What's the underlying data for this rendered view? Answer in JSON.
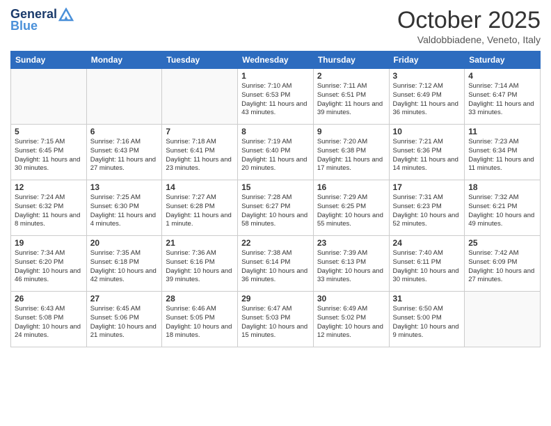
{
  "header": {
    "logo_line1": "General",
    "logo_line2": "Blue",
    "month": "October 2025",
    "location": "Valdobbiadene, Veneto, Italy"
  },
  "days_of_week": [
    "Sunday",
    "Monday",
    "Tuesday",
    "Wednesday",
    "Thursday",
    "Friday",
    "Saturday"
  ],
  "weeks": [
    [
      {
        "day": "",
        "text": "",
        "empty": true
      },
      {
        "day": "",
        "text": "",
        "empty": true
      },
      {
        "day": "",
        "text": "",
        "empty": true
      },
      {
        "day": "1",
        "text": "Sunrise: 7:10 AM\nSunset: 6:53 PM\nDaylight: 11 hours and 43 minutes."
      },
      {
        "day": "2",
        "text": "Sunrise: 7:11 AM\nSunset: 6:51 PM\nDaylight: 11 hours and 39 minutes."
      },
      {
        "day": "3",
        "text": "Sunrise: 7:12 AM\nSunset: 6:49 PM\nDaylight: 11 hours and 36 minutes."
      },
      {
        "day": "4",
        "text": "Sunrise: 7:14 AM\nSunset: 6:47 PM\nDaylight: 11 hours and 33 minutes."
      }
    ],
    [
      {
        "day": "5",
        "text": "Sunrise: 7:15 AM\nSunset: 6:45 PM\nDaylight: 11 hours and 30 minutes."
      },
      {
        "day": "6",
        "text": "Sunrise: 7:16 AM\nSunset: 6:43 PM\nDaylight: 11 hours and 27 minutes."
      },
      {
        "day": "7",
        "text": "Sunrise: 7:18 AM\nSunset: 6:41 PM\nDaylight: 11 hours and 23 minutes."
      },
      {
        "day": "8",
        "text": "Sunrise: 7:19 AM\nSunset: 6:40 PM\nDaylight: 11 hours and 20 minutes."
      },
      {
        "day": "9",
        "text": "Sunrise: 7:20 AM\nSunset: 6:38 PM\nDaylight: 11 hours and 17 minutes."
      },
      {
        "day": "10",
        "text": "Sunrise: 7:21 AM\nSunset: 6:36 PM\nDaylight: 11 hours and 14 minutes."
      },
      {
        "day": "11",
        "text": "Sunrise: 7:23 AM\nSunset: 6:34 PM\nDaylight: 11 hours and 11 minutes."
      }
    ],
    [
      {
        "day": "12",
        "text": "Sunrise: 7:24 AM\nSunset: 6:32 PM\nDaylight: 11 hours and 8 minutes."
      },
      {
        "day": "13",
        "text": "Sunrise: 7:25 AM\nSunset: 6:30 PM\nDaylight: 11 hours and 4 minutes."
      },
      {
        "day": "14",
        "text": "Sunrise: 7:27 AM\nSunset: 6:28 PM\nDaylight: 11 hours and 1 minute."
      },
      {
        "day": "15",
        "text": "Sunrise: 7:28 AM\nSunset: 6:27 PM\nDaylight: 10 hours and 58 minutes."
      },
      {
        "day": "16",
        "text": "Sunrise: 7:29 AM\nSunset: 6:25 PM\nDaylight: 10 hours and 55 minutes."
      },
      {
        "day": "17",
        "text": "Sunrise: 7:31 AM\nSunset: 6:23 PM\nDaylight: 10 hours and 52 minutes."
      },
      {
        "day": "18",
        "text": "Sunrise: 7:32 AM\nSunset: 6:21 PM\nDaylight: 10 hours and 49 minutes."
      }
    ],
    [
      {
        "day": "19",
        "text": "Sunrise: 7:34 AM\nSunset: 6:20 PM\nDaylight: 10 hours and 46 minutes."
      },
      {
        "day": "20",
        "text": "Sunrise: 7:35 AM\nSunset: 6:18 PM\nDaylight: 10 hours and 42 minutes."
      },
      {
        "day": "21",
        "text": "Sunrise: 7:36 AM\nSunset: 6:16 PM\nDaylight: 10 hours and 39 minutes."
      },
      {
        "day": "22",
        "text": "Sunrise: 7:38 AM\nSunset: 6:14 PM\nDaylight: 10 hours and 36 minutes."
      },
      {
        "day": "23",
        "text": "Sunrise: 7:39 AM\nSunset: 6:13 PM\nDaylight: 10 hours and 33 minutes."
      },
      {
        "day": "24",
        "text": "Sunrise: 7:40 AM\nSunset: 6:11 PM\nDaylight: 10 hours and 30 minutes."
      },
      {
        "day": "25",
        "text": "Sunrise: 7:42 AM\nSunset: 6:09 PM\nDaylight: 10 hours and 27 minutes."
      }
    ],
    [
      {
        "day": "26",
        "text": "Sunrise: 6:43 AM\nSunset: 5:08 PM\nDaylight: 10 hours and 24 minutes."
      },
      {
        "day": "27",
        "text": "Sunrise: 6:45 AM\nSunset: 5:06 PM\nDaylight: 10 hours and 21 minutes."
      },
      {
        "day": "28",
        "text": "Sunrise: 6:46 AM\nSunset: 5:05 PM\nDaylight: 10 hours and 18 minutes."
      },
      {
        "day": "29",
        "text": "Sunrise: 6:47 AM\nSunset: 5:03 PM\nDaylight: 10 hours and 15 minutes."
      },
      {
        "day": "30",
        "text": "Sunrise: 6:49 AM\nSunset: 5:02 PM\nDaylight: 10 hours and 12 minutes."
      },
      {
        "day": "31",
        "text": "Sunrise: 6:50 AM\nSunset: 5:00 PM\nDaylight: 10 hours and 9 minutes."
      },
      {
        "day": "",
        "text": "",
        "empty": true
      }
    ]
  ]
}
